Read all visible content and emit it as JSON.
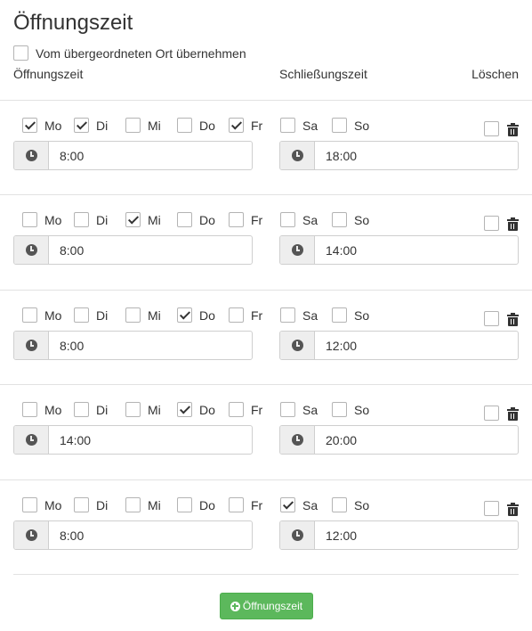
{
  "page": {
    "title": "Öffnungszeit"
  },
  "inherit": {
    "label": "Vom übergeordneten Ort übernehmen",
    "checked": false
  },
  "columns": {
    "open": "Öffnungszeit",
    "close": "Schließungszeit",
    "delete": "Löschen"
  },
  "icons": {
    "clock": "clock-icon",
    "trash": "trash-icon",
    "add": "plus-circle-icon"
  },
  "entries": [
    {
      "days": [
        {
          "label": "Mo",
          "checked": true
        },
        {
          "label": "Di",
          "checked": true
        },
        {
          "label": "Mi",
          "checked": false
        },
        {
          "label": "Do",
          "checked": false
        },
        {
          "label": "Fr",
          "checked": true
        },
        {
          "label": "Sa",
          "checked": false
        },
        {
          "label": "So",
          "checked": false
        }
      ],
      "open": "8:00",
      "close": "18:00",
      "delete_checked": false
    },
    {
      "days": [
        {
          "label": "Mo",
          "checked": false
        },
        {
          "label": "Di",
          "checked": false
        },
        {
          "label": "Mi",
          "checked": true
        },
        {
          "label": "Do",
          "checked": false
        },
        {
          "label": "Fr",
          "checked": false
        },
        {
          "label": "Sa",
          "checked": false
        },
        {
          "label": "So",
          "checked": false
        }
      ],
      "open": "8:00",
      "close": "14:00",
      "delete_checked": false
    },
    {
      "days": [
        {
          "label": "Mo",
          "checked": false
        },
        {
          "label": "Di",
          "checked": false
        },
        {
          "label": "Mi",
          "checked": false
        },
        {
          "label": "Do",
          "checked": true
        },
        {
          "label": "Fr",
          "checked": false
        },
        {
          "label": "Sa",
          "checked": false
        },
        {
          "label": "So",
          "checked": false
        }
      ],
      "open": "8:00",
      "close": "12:00",
      "delete_checked": false
    },
    {
      "days": [
        {
          "label": "Mo",
          "checked": false
        },
        {
          "label": "Di",
          "checked": false
        },
        {
          "label": "Mi",
          "checked": false
        },
        {
          "label": "Do",
          "checked": true
        },
        {
          "label": "Fr",
          "checked": false
        },
        {
          "label": "Sa",
          "checked": false
        },
        {
          "label": "So",
          "checked": false
        }
      ],
      "open": "14:00",
      "close": "20:00",
      "delete_checked": false
    },
    {
      "days": [
        {
          "label": "Mo",
          "checked": false
        },
        {
          "label": "Di",
          "checked": false
        },
        {
          "label": "Mi",
          "checked": false
        },
        {
          "label": "Do",
          "checked": false
        },
        {
          "label": "Fr",
          "checked": false
        },
        {
          "label": "Sa",
          "checked": true
        },
        {
          "label": "So",
          "checked": false
        }
      ],
      "open": "8:00",
      "close": "12:00",
      "delete_checked": false
    }
  ],
  "add_button": {
    "label": "Öffnungszeit",
    "color": "#5cb85c"
  }
}
